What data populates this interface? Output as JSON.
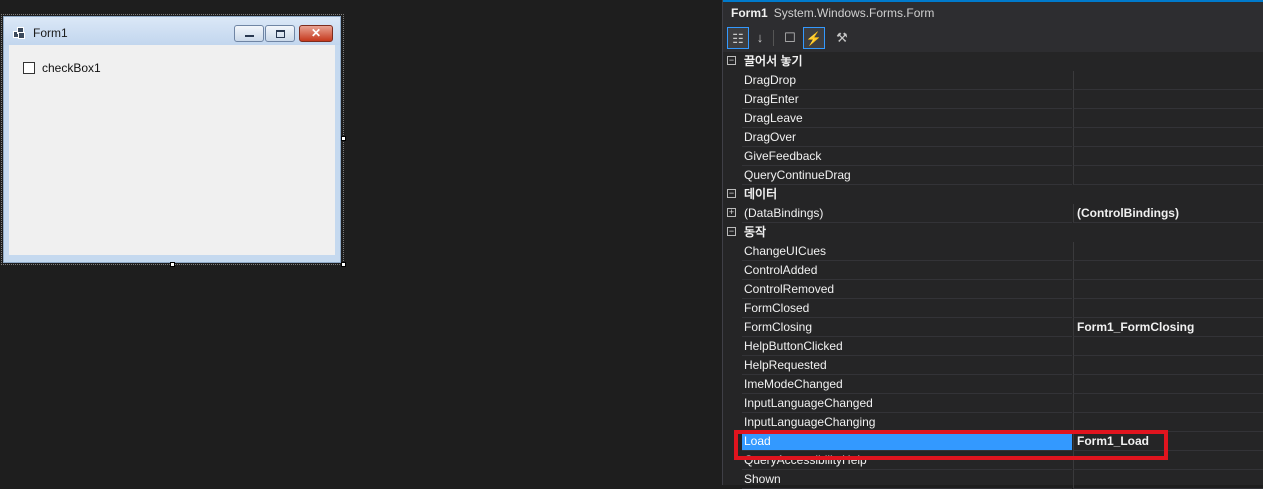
{
  "form": {
    "title": "Form1",
    "checkbox_label": "checkBox1",
    "close_glyph": "✕"
  },
  "properties": {
    "object_name": "Form1",
    "object_type": "System.Windows.Forms.Form",
    "toolbar": [
      {
        "icon": "categorized-icon",
        "glyph": "☷",
        "active": true
      },
      {
        "icon": "alphabetical-icon",
        "glyph": "↓",
        "active": false
      },
      {
        "icon": "properties-icon",
        "glyph": "☐",
        "active": false
      },
      {
        "icon": "events-icon",
        "glyph": "⚡",
        "active": true
      },
      {
        "icon": "property-pages-icon",
        "glyph": "⚒",
        "active": false
      }
    ],
    "rows": [
      {
        "kind": "category",
        "name": "끌어서 놓기",
        "expander": "−"
      },
      {
        "kind": "prop",
        "name": "DragDrop",
        "value": ""
      },
      {
        "kind": "prop",
        "name": "DragEnter",
        "value": ""
      },
      {
        "kind": "prop",
        "name": "DragLeave",
        "value": ""
      },
      {
        "kind": "prop",
        "name": "DragOver",
        "value": ""
      },
      {
        "kind": "prop",
        "name": "GiveFeedback",
        "value": ""
      },
      {
        "kind": "prop",
        "name": "QueryContinueDrag",
        "value": ""
      },
      {
        "kind": "category",
        "name": "데이터",
        "expander": "−"
      },
      {
        "kind": "prop",
        "name": "(DataBindings)",
        "value": "(ControlBindings)",
        "expander": "+"
      },
      {
        "kind": "category",
        "name": "동작",
        "expander": "−"
      },
      {
        "kind": "prop",
        "name": "ChangeUICues",
        "value": ""
      },
      {
        "kind": "prop",
        "name": "ControlAdded",
        "value": ""
      },
      {
        "kind": "prop",
        "name": "ControlRemoved",
        "value": ""
      },
      {
        "kind": "prop",
        "name": "FormClosed",
        "value": ""
      },
      {
        "kind": "prop",
        "name": "FormClosing",
        "value": "Form1_FormClosing"
      },
      {
        "kind": "prop",
        "name": "HelpButtonClicked",
        "value": ""
      },
      {
        "kind": "prop",
        "name": "HelpRequested",
        "value": ""
      },
      {
        "kind": "prop",
        "name": "ImeModeChanged",
        "value": ""
      },
      {
        "kind": "prop",
        "name": "InputLanguageChanged",
        "value": ""
      },
      {
        "kind": "prop",
        "name": "InputLanguageChanging",
        "value": ""
      },
      {
        "kind": "prop",
        "name": "Load",
        "value": "Form1_Load",
        "selected": true
      },
      {
        "kind": "prop",
        "name": "QueryAccessibilityHelp",
        "value": ""
      },
      {
        "kind": "prop",
        "name": "Shown",
        "value": ""
      }
    ]
  },
  "colors": {
    "selection": "#3399ff",
    "annotation": "#e0141e",
    "accent": "#007acc"
  }
}
